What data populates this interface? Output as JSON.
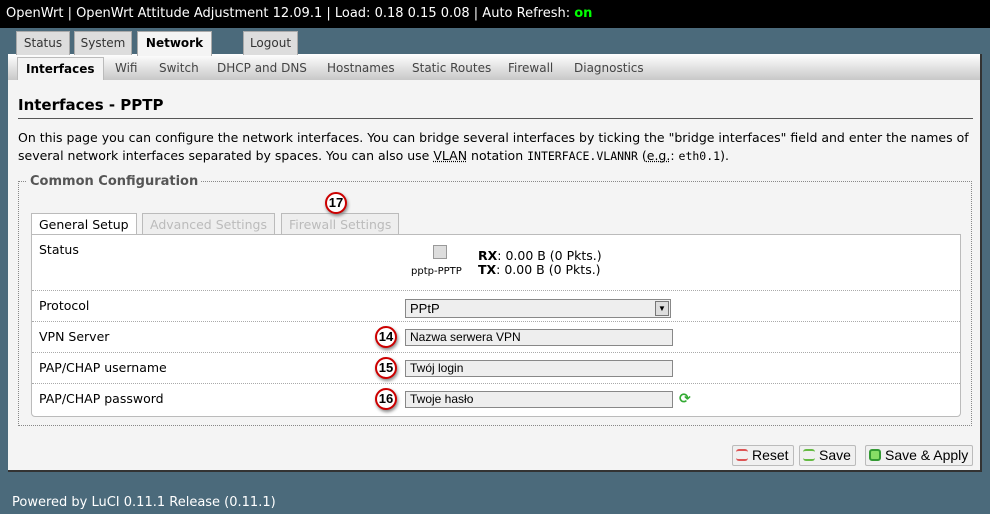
{
  "header": {
    "text": "OpenWrt | OpenWrt Attitude Adjustment 12.09.1 | Load: 0.18 0.15 0.08 | Auto Refresh: ",
    "auto_refresh": "on"
  },
  "main_tabs": [
    "Status",
    "System",
    "Network",
    "Logout"
  ],
  "sub_nav": [
    "Interfaces",
    "Wifi",
    "Switch",
    "DHCP and DNS",
    "Hostnames",
    "Static Routes",
    "Firewall",
    "Diagnostics"
  ],
  "page_title": "Interfaces - PPTP",
  "description": {
    "p1": "On this page you can configure the network interfaces. You can bridge several interfaces by ticking the \"bridge interfaces\" field and enter the names of several network interfaces separated by spaces. You can also use ",
    "vlan": "VLAN",
    "p2": " notation ",
    "code1": "INTERFACE.VLANNR",
    "p3": " (",
    "eg": "e.g.",
    "p4": ": ",
    "code2": "eth0.1",
    "p5": ")."
  },
  "fieldset": {
    "legend": "Common Configuration",
    "tabs": [
      "General Setup",
      "Advanced Settings",
      "Firewall Settings"
    ]
  },
  "status": {
    "label": "Status",
    "iface": "pptp-PPTP",
    "rx_label": "RX",
    "rx": ": 0.00 B (0 Pkts.)",
    "tx_label": "TX",
    "tx": ": 0.00 B (0 Pkts.)"
  },
  "fields": {
    "protocol": {
      "label": "Protocol",
      "value": "PPtP"
    },
    "vpn_server": {
      "label": "VPN Server",
      "value": "Nazwa serwera VPN",
      "badge": "14"
    },
    "username": {
      "label": "PAP/CHAP username",
      "value": "Twój login",
      "badge": "15"
    },
    "password": {
      "label": "PAP/CHAP password",
      "value": "Twoje hasło",
      "badge": "16"
    }
  },
  "tab_badge": "17",
  "buttons": {
    "reset": "Reset",
    "save": "Save",
    "save_apply": "Save & Apply"
  },
  "footer": "Powered by LuCI 0.11.1 Release (0.11.1)"
}
